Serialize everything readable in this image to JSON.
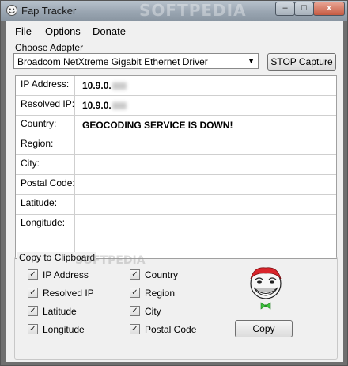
{
  "window": {
    "title": "Fap Tracker",
    "watermark": "SOFTPEDIA",
    "controls": {
      "minimize": "–",
      "maximize": "□",
      "close": "x"
    }
  },
  "menu": [
    "File",
    "Options",
    "Donate"
  ],
  "adapter": {
    "label": "Choose Adapter",
    "selected": "Broadcom NetXtreme Gigabit Ethernet Driver",
    "capture_button": "STOP Capture"
  },
  "info_rows": [
    {
      "label": "IP Address:",
      "value": "10.9.0."
    },
    {
      "label": "Resolved IP:",
      "value": "10.9.0."
    },
    {
      "label": "Country:",
      "value": "GEOCODING SERVICE IS DOWN!"
    },
    {
      "label": "Region:",
      "value": ""
    },
    {
      "label": "City:",
      "value": ""
    },
    {
      "label": "Postal Code:",
      "value": ""
    },
    {
      "label": "Latitude:",
      "value": ""
    },
    {
      "label": "Longitude:",
      "value": ""
    }
  ],
  "clipboard": {
    "title": "Copy to Clipboard",
    "watermark": "SOFTPEDIA",
    "options_left": [
      {
        "label": "IP Address",
        "checked": true
      },
      {
        "label": "Resolved IP",
        "checked": true
      },
      {
        "label": "Latitude",
        "checked": true
      },
      {
        "label": "Longitude",
        "checked": true
      }
    ],
    "options_right": [
      {
        "label": "Country",
        "checked": true
      },
      {
        "label": "Region",
        "checked": true
      },
      {
        "label": "City",
        "checked": true
      },
      {
        "label": "Postal Code",
        "checked": true
      }
    ],
    "copy_button": "Copy"
  },
  "colors": {
    "accent_bowtie": "#3cc23c",
    "troll_hair": "#d9252b"
  }
}
